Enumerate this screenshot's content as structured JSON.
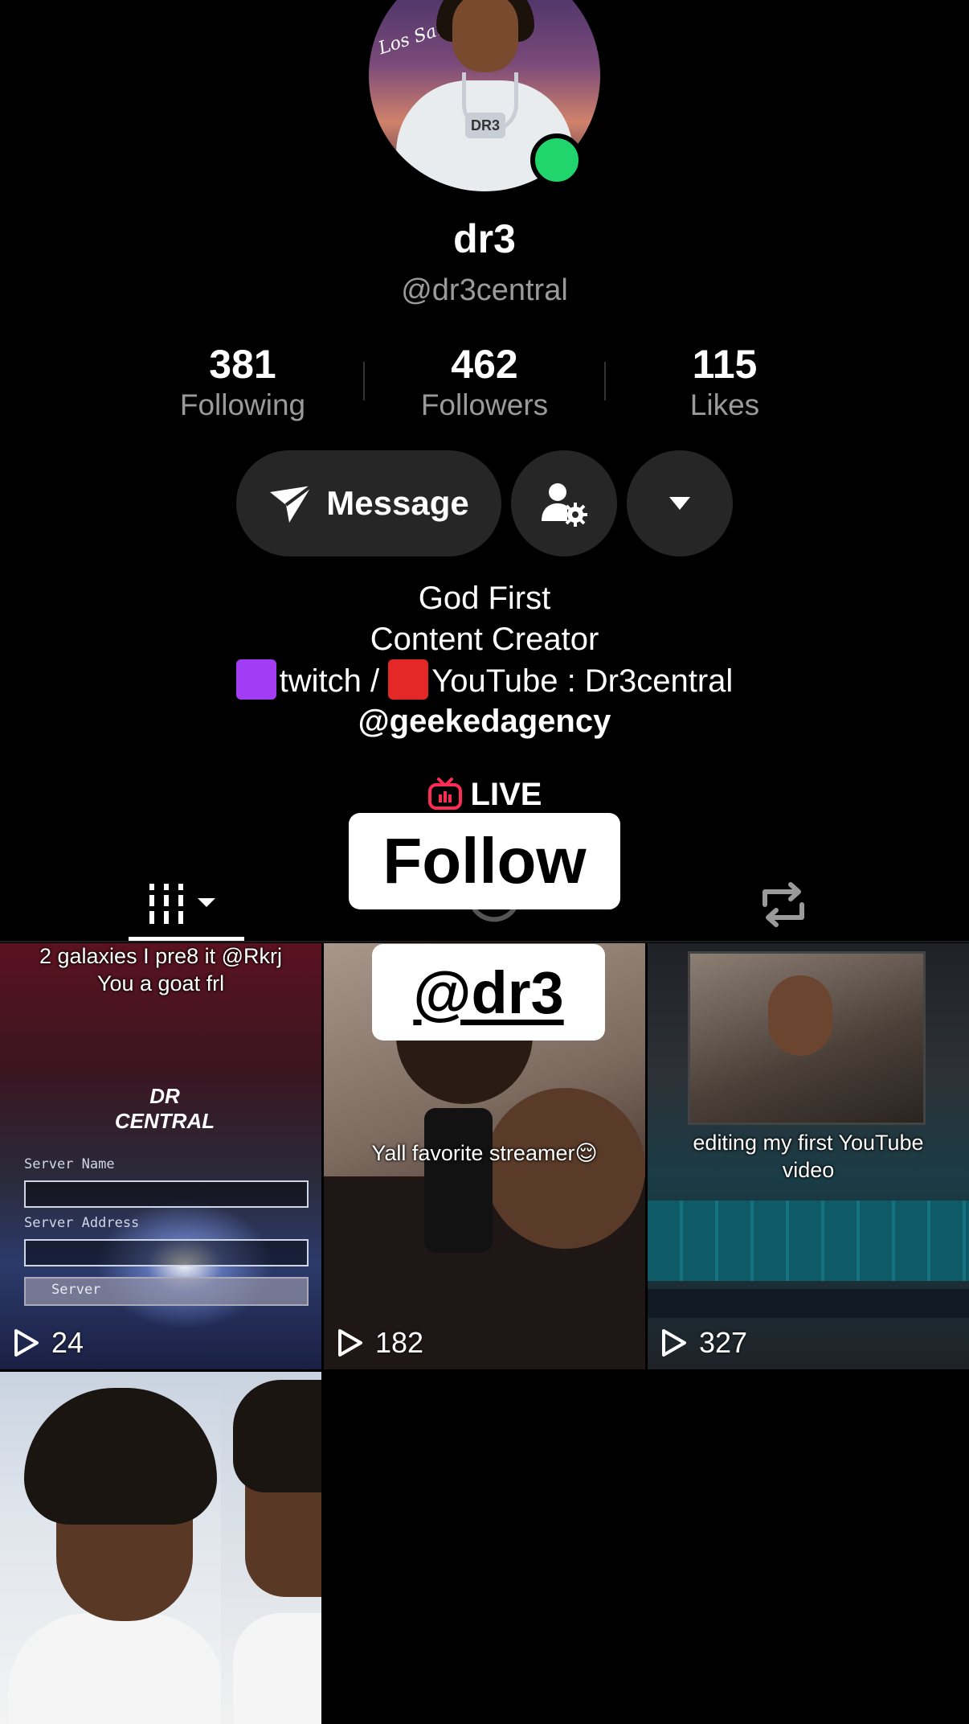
{
  "profile": {
    "display_name": "dr3",
    "handle": "@dr3central"
  },
  "stats": [
    {
      "value": "381",
      "label": "Following"
    },
    {
      "value": "462",
      "label": "Followers"
    },
    {
      "value": "115",
      "label": "Likes"
    }
  ],
  "buttons": {
    "message_label": "Message"
  },
  "bio": {
    "line1": "God First",
    "line2": "Content Creator",
    "line3_a": "twitch / ",
    "line3_b": "YouTube : Dr3central",
    "link": "@geekedagency"
  },
  "live_label": "LIVE",
  "overlays": {
    "follow": "Follow",
    "handle": "@dr3"
  },
  "videos": [
    {
      "caption_1": "2 galaxies I pre8 it @Rkrj",
      "caption_2": "You a goat frl",
      "logo": "DR CENTRAL",
      "field_1": "Server Name",
      "field_2": "Server Address",
      "field_3": "Server",
      "plays": "24"
    },
    {
      "caption_1": "Yall favorite streamer😌",
      "plays": "182"
    },
    {
      "caption_1": "editing my first YouTube",
      "caption_2": "video",
      "plays": "327"
    },
    {}
  ],
  "colors": {
    "background": "#000000",
    "button_bg": "#262626",
    "online": "#20d56b",
    "live_icon": "#fe2c55",
    "muted_text": "#9a9a9a"
  },
  "icons": {
    "message": "paper-plane-icon",
    "user_settings": "user-gear-icon",
    "dropdown": "caret-down-icon",
    "live": "tv-icon",
    "grid_tab": "grid-icon",
    "repost_tab": "repost-icon",
    "play": "play-icon"
  }
}
